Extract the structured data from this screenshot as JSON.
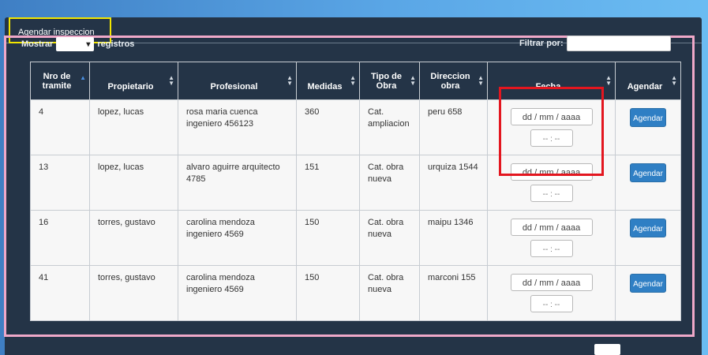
{
  "tab": {
    "label": "Agendar inspeccion"
  },
  "controls": {
    "mostrar_label": "Mostrar",
    "page_size_value": "",
    "registros_label": "registros",
    "filtrar_label": "Filtrar por:"
  },
  "table": {
    "headers": [
      "Nro de tramite",
      "Propietario",
      "Profesional",
      "Medidas",
      "Tipo de Obra",
      "Direccion obra",
      "Fecha",
      "Agendar"
    ],
    "date_placeholder": "dd / mm / aaaa",
    "time_placeholder": "-- : --",
    "button_label": "Agendar",
    "rows": [
      {
        "nro": "4",
        "propietario": "lopez, lucas",
        "profesional": "rosa maria cuenca ingeniero 456123",
        "medidas": "360",
        "tipo": "Cat. ampliacion",
        "direccion": "peru 658"
      },
      {
        "nro": "13",
        "propietario": "lopez, lucas",
        "profesional": "alvaro aguirre arquitecto 4785",
        "medidas": "151",
        "tipo": "Cat. obra nueva",
        "direccion": "urquiza 1544"
      },
      {
        "nro": "16",
        "propietario": "torres, gustavo",
        "profesional": "carolina mendoza ingeniero 4569",
        "medidas": "150",
        "tipo": "Cat. obra nueva",
        "direccion": "maipu 1346"
      },
      {
        "nro": "41",
        "propietario": "torres, gustavo",
        "profesional": "carolina mendoza ingeniero 4569",
        "medidas": "150",
        "tipo": "Cat. obra nueva",
        "direccion": "marconi 155"
      }
    ]
  }
}
